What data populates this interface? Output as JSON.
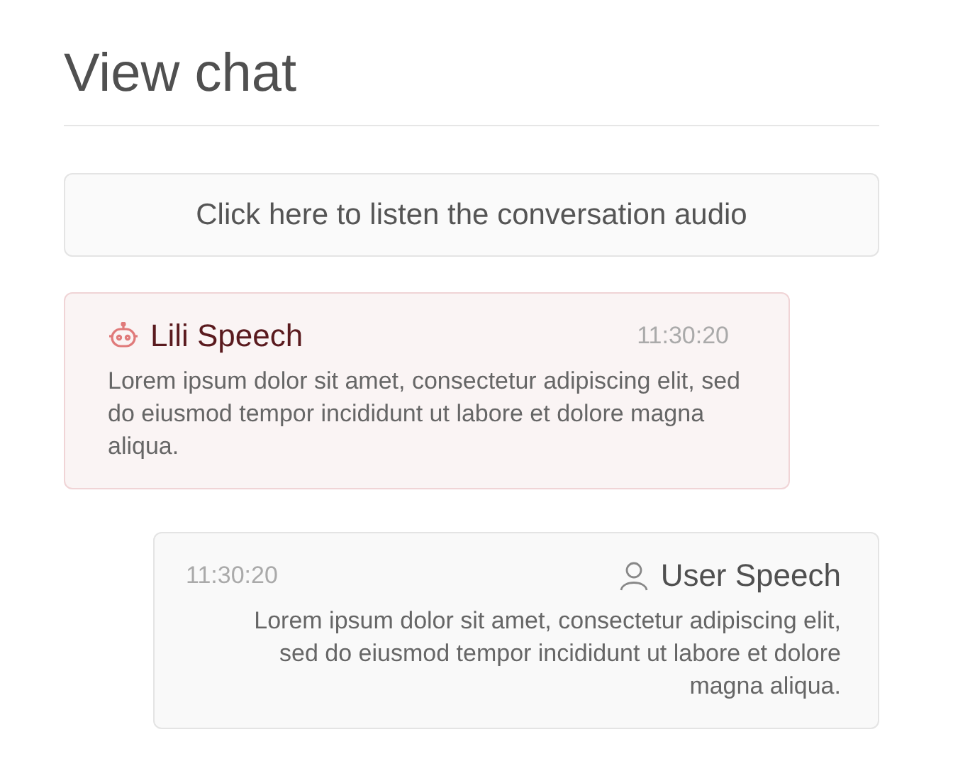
{
  "title": "View chat",
  "audio_button": {
    "label": "Click here to listen the conversation audio"
  },
  "messages": [
    {
      "kind": "bot",
      "speaker": "Lili Speech",
      "time": "11:30:20",
      "text": "Lorem ipsum dolor sit amet, consectetur adipiscing elit, sed do eiusmod tempor incididunt ut labore et dolore magna aliqua."
    },
    {
      "kind": "user",
      "speaker": "User Speech",
      "time": "11:30:20",
      "text": "Lorem ipsum dolor sit amet, consectetur adipiscing elit, sed do eiusmod tempor incididunt ut labore et dolore magna aliqua."
    }
  ]
}
